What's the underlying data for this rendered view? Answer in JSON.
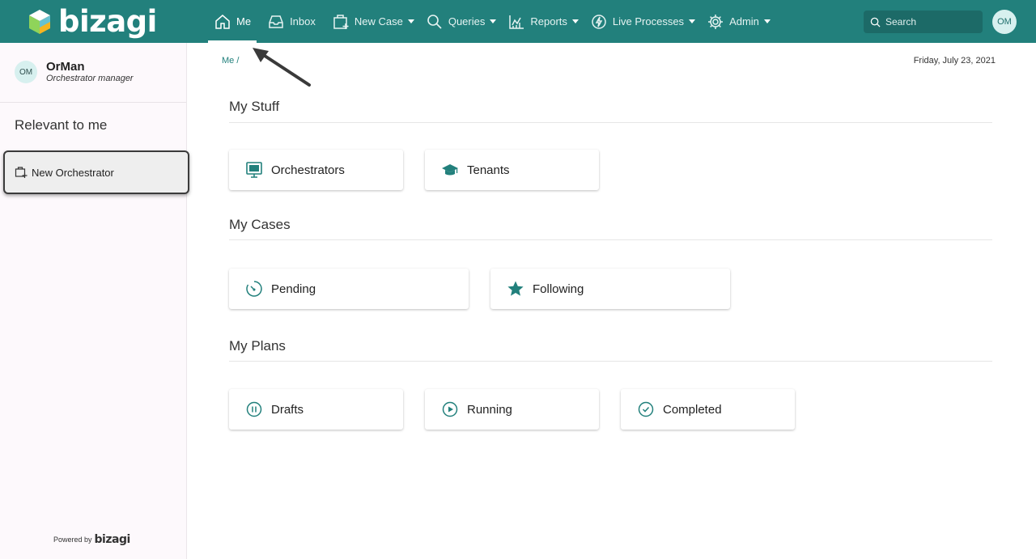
{
  "app": {
    "logo_text": "bizagi"
  },
  "nav": {
    "items": [
      {
        "label": "Me",
        "icon": "home-icon",
        "active": true,
        "dropdown": false
      },
      {
        "label": "Inbox",
        "icon": "inbox-icon",
        "active": false,
        "dropdown": false
      },
      {
        "label": "New Case",
        "icon": "new-case-icon",
        "active": false,
        "dropdown": true
      },
      {
        "label": "Queries",
        "icon": "search-icon",
        "active": false,
        "dropdown": true
      },
      {
        "label": "Reports",
        "icon": "chart-icon",
        "active": false,
        "dropdown": true
      },
      {
        "label": "Live Processes",
        "icon": "lightning-icon",
        "active": false,
        "dropdown": true
      },
      {
        "label": "Admin",
        "icon": "gear-icon",
        "active": false,
        "dropdown": true
      }
    ]
  },
  "search": {
    "placeholder": "Search"
  },
  "user": {
    "initials": "OM",
    "name": "OrMan",
    "role": "Orchestrator manager"
  },
  "sidebar": {
    "heading": "Relevant to me",
    "item_label": "New Orchestrator",
    "powered_by": "Powered by",
    "powered_logo": "bizagi"
  },
  "main": {
    "breadcrumb": "Me /",
    "date": "Friday, July 23, 2021",
    "sections": [
      {
        "title": "My Stuff",
        "cards": [
          "Orchestrators",
          "Tenants"
        ]
      },
      {
        "title": "My Cases",
        "cards": [
          "Pending",
          "Following"
        ]
      },
      {
        "title": "My Plans",
        "cards": [
          "Drafts",
          "Running",
          "Completed"
        ]
      }
    ]
  },
  "colors": {
    "brand": "#22807c",
    "sidebar_bg": "#fdf9fc",
    "accent_text": "#22807c"
  }
}
